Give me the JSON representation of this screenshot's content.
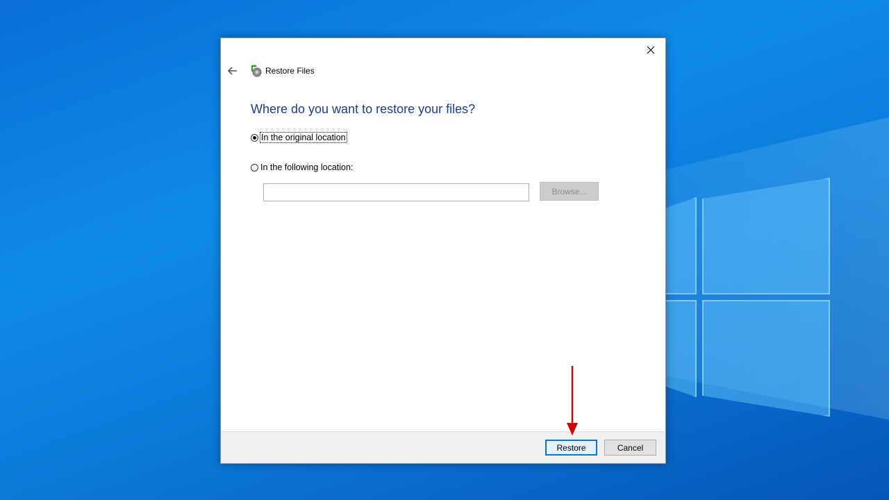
{
  "dialog": {
    "app_title": "Restore Files",
    "heading": "Where do you want to restore your files?",
    "option_original": "In the original location",
    "option_following": "In the following location:",
    "location_value": "",
    "browse_label": "Browse...",
    "restore_label": "Restore",
    "cancel_label": "Cancel"
  },
  "colors": {
    "heading": "#1e3c8c",
    "primary_border": "#0078d7",
    "annotation_arrow": "#d40000"
  },
  "icons": [
    "close-icon",
    "back-arrow-icon",
    "restore-files-icon"
  ]
}
